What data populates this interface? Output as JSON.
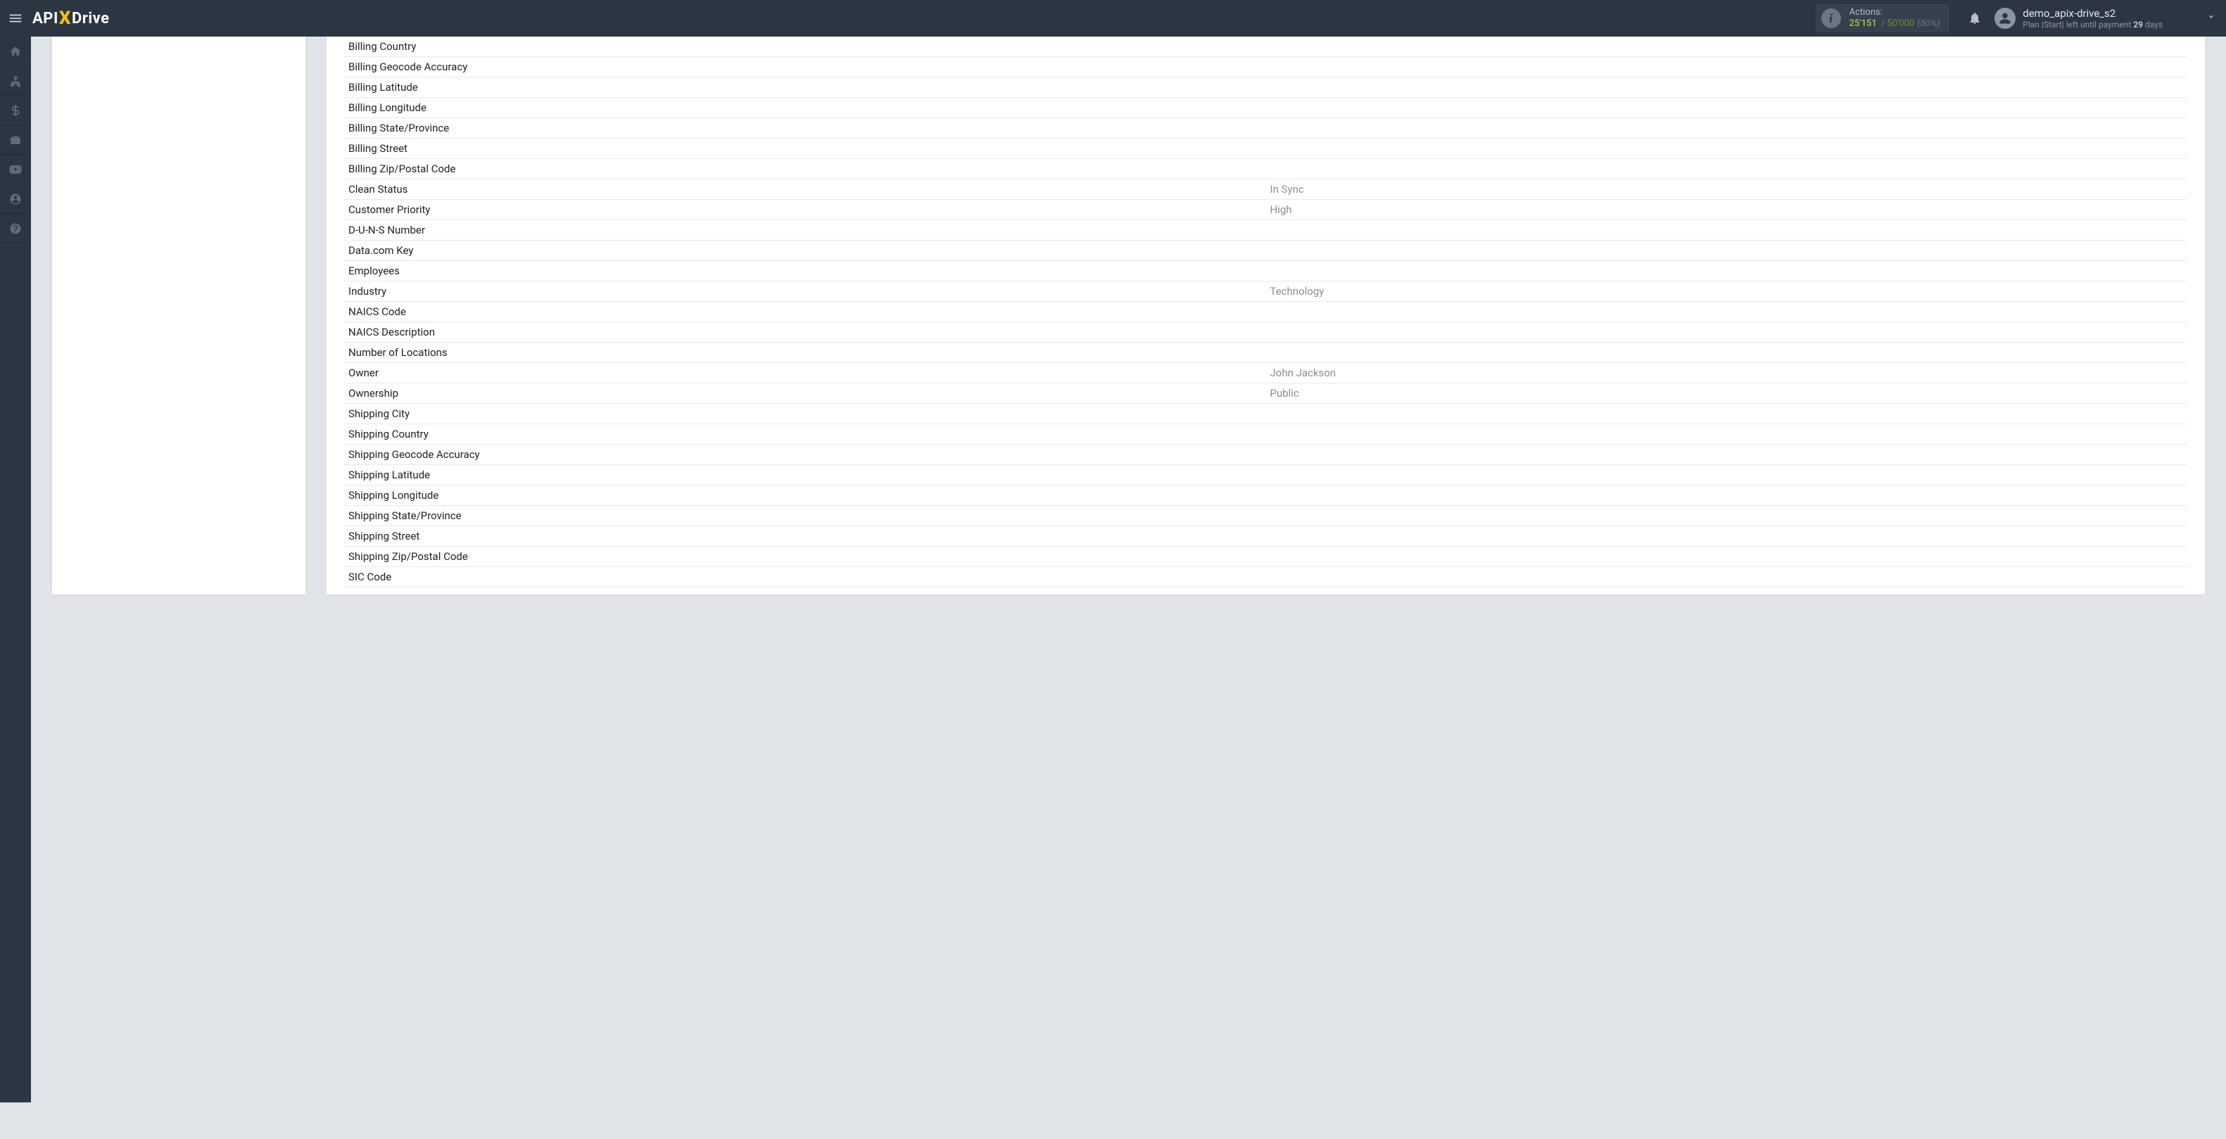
{
  "header": {
    "logo_prefix": "API",
    "logo_x": "X",
    "logo_suffix": "Drive",
    "actions": {
      "label": "Actions:",
      "used": "25'151",
      "total": "50'000",
      "pct": "(50%)"
    },
    "user": {
      "name": "demo_apix-drive_s2",
      "plan_prefix": "Plan |",
      "plan_name": "Start",
      "plan_mid": "| left until payment ",
      "plan_days": "29",
      "plan_suffix": " days"
    }
  },
  "fields": [
    {
      "label": "Billing Country",
      "value": ""
    },
    {
      "label": "Billing Geocode Accuracy",
      "value": ""
    },
    {
      "label": "Billing Latitude",
      "value": ""
    },
    {
      "label": "Billing Longitude",
      "value": ""
    },
    {
      "label": "Billing State/Province",
      "value": ""
    },
    {
      "label": "Billing Street",
      "value": ""
    },
    {
      "label": "Billing Zip/Postal Code",
      "value": ""
    },
    {
      "label": "Clean Status",
      "value": "In Sync"
    },
    {
      "label": "Customer Priority",
      "value": "High"
    },
    {
      "label": "D-U-N-S Number",
      "value": ""
    },
    {
      "label": "Data.com Key",
      "value": ""
    },
    {
      "label": "Employees",
      "value": ""
    },
    {
      "label": "Industry",
      "value": "Technology"
    },
    {
      "label": "NAICS Code",
      "value": ""
    },
    {
      "label": "NAICS Description",
      "value": ""
    },
    {
      "label": "Number of Locations",
      "value": ""
    },
    {
      "label": "Owner",
      "value": "John Jackson"
    },
    {
      "label": "Ownership",
      "value": "Public"
    },
    {
      "label": "Shipping City",
      "value": ""
    },
    {
      "label": "Shipping Country",
      "value": ""
    },
    {
      "label": "Shipping Geocode Accuracy",
      "value": ""
    },
    {
      "label": "Shipping Latitude",
      "value": ""
    },
    {
      "label": "Shipping Longitude",
      "value": ""
    },
    {
      "label": "Shipping State/Province",
      "value": ""
    },
    {
      "label": "Shipping Street",
      "value": ""
    },
    {
      "label": "Shipping Zip/Postal Code",
      "value": ""
    },
    {
      "label": "SIC Code",
      "value": ""
    }
  ]
}
